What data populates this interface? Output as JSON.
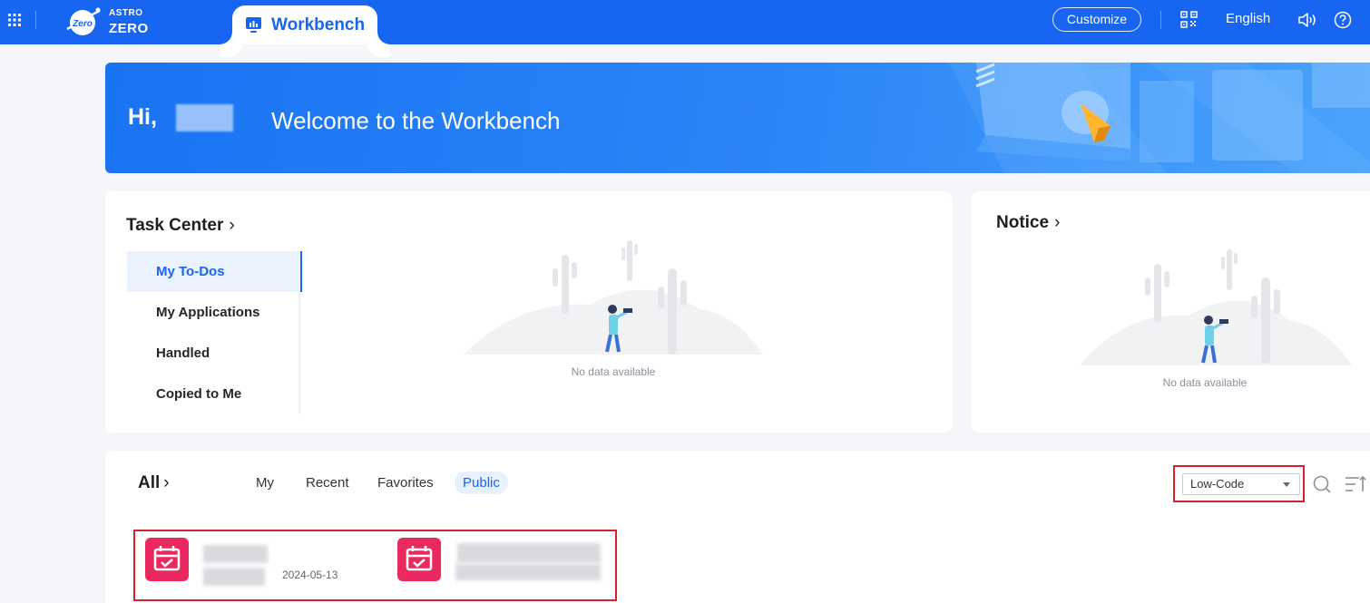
{
  "topbar": {
    "brand_top": "ASTRO",
    "brand_bottom": "ZERO",
    "logo_badge": "Zero",
    "workbench_tab": "Workbench",
    "customize_label": "Customize",
    "language_label": "English",
    "icons": [
      "apps-grid-icon",
      "qr-code-icon",
      "speaker-icon",
      "help-icon"
    ]
  },
  "banner": {
    "greeting": "Hi,",
    "welcome": "Welcome to the Workbench"
  },
  "task_center": {
    "title": "Task Center",
    "chevron": "›",
    "menu": [
      {
        "label": "My To-Dos",
        "active": true
      },
      {
        "label": "My Applications",
        "active": false
      },
      {
        "label": "Handled",
        "active": false
      },
      {
        "label": "Copied to Me",
        "active": false
      }
    ],
    "empty_text": "No data available"
  },
  "notice": {
    "title": "Notice",
    "chevron": "›",
    "empty_text": "No data available"
  },
  "apps": {
    "title": "All",
    "chevron": "›",
    "tabs": [
      {
        "label": "My",
        "active": false
      },
      {
        "label": "Recent",
        "active": false
      },
      {
        "label": "Favorites",
        "active": false
      },
      {
        "label": "Public",
        "active": true
      }
    ],
    "category_selected": "Low-Code",
    "items": [
      {
        "date": "2024-05-13",
        "icon": "calendar-check-icon"
      },
      {
        "date": "",
        "icon": "calendar-check-icon"
      }
    ]
  },
  "colors": {
    "primary": "#1865f2",
    "app_icon": "#ea2a5f",
    "highlight": "#d6202a"
  }
}
